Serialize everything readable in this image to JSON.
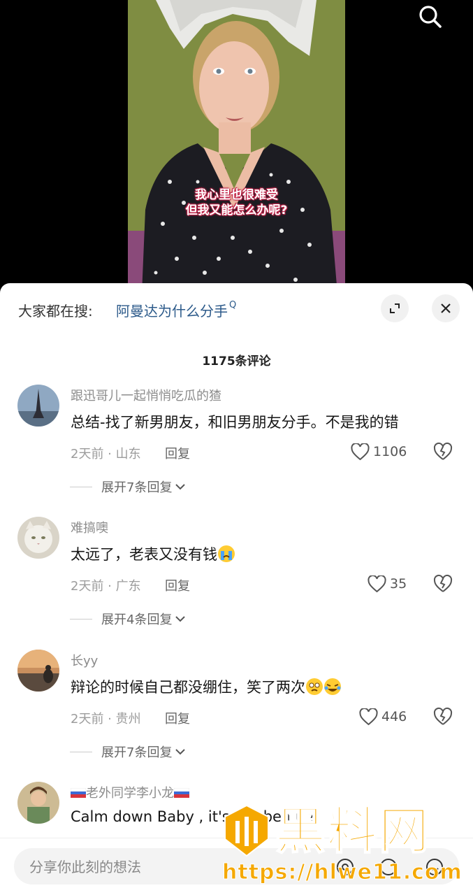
{
  "video": {
    "subtitle_line1": "我心里也很难受",
    "subtitle_line2": "但我又能怎么办呢?",
    "search_icon": "search-icon"
  },
  "sheet": {
    "hot_search_label": "大家都在搜:",
    "hot_search_term": "阿曼达为什么分手",
    "hot_search_suffix": "Q",
    "expand_icon": "expand-icon",
    "close_icon": "close-icon",
    "comment_count": "1175条评论"
  },
  "comments": [
    {
      "username": "跟迅哥儿一起悄悄吃瓜的猹",
      "text": "总结-找了新男朋友，和旧男朋友分手。不是我的错",
      "meta": "2天前 · 山东",
      "reply_label": "回复",
      "likes": "1106",
      "expand_label": "展开7条回复"
    },
    {
      "username": "难搞噢",
      "text": "太远了，老表又没有钱",
      "meta": "2天前 · 广东",
      "reply_label": "回复",
      "likes": "35",
      "expand_label": "展开4条回复"
    },
    {
      "username": "长yy",
      "text": "辩论的时候自己都没绷住，笑了两次",
      "meta": "2天前 · 贵州",
      "reply_label": "回复",
      "likes": "446",
      "expand_label": "展开7条回复"
    },
    {
      "username": "老外同学李小龙",
      "text": "Calm down Baby , it's will be fine"
    }
  ],
  "input": {
    "placeholder": "分享你此刻的想法"
  },
  "watermark": {
    "title": "黑料网",
    "url": "https://hlwe11.com"
  },
  "colors": {
    "accent_link": "#2c5a8a",
    "watermark": "#f5a800"
  }
}
